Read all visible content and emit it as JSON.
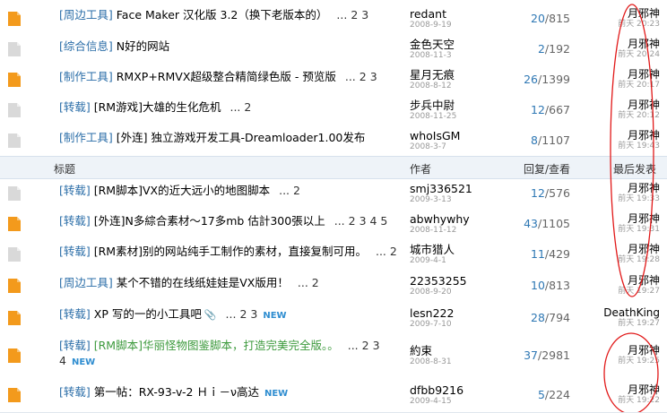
{
  "header": {
    "title_label": "标题",
    "author_label": "作者",
    "stats_label": "回复/查看",
    "last_post_label": "最后发表"
  },
  "rows": [
    {
      "icon": "hot",
      "category": "[周边工具]",
      "title": "Face Maker 汉化版 3.2（换下老版本的）",
      "title_color": "normal",
      "pages": "2 3",
      "new": "",
      "clip": false,
      "author": "redant",
      "date": "2008-9-19",
      "replies": "20",
      "views": "815",
      "lp_name": "月邪神",
      "lp_time": "前天 20:23"
    },
    {
      "icon": "normal",
      "category": "[综合信息]",
      "title": "N好的网站",
      "title_color": "normal",
      "pages": "",
      "new": "",
      "clip": false,
      "author": "金色天空",
      "date": "2008-11-3",
      "replies": "2",
      "views": "192",
      "lp_name": "月邪神",
      "lp_time": "前天 20:24"
    },
    {
      "icon": "hot",
      "category": "[制作工具]",
      "title": "RMXP+RMVX超级整合精简绿色版 - 预览版",
      "title_color": "normal",
      "pages": "2 3",
      "new": "",
      "clip": false,
      "author": "星月无痕",
      "date": "2008-8-12",
      "replies": "26",
      "views": "1399",
      "lp_name": "月邪神",
      "lp_time": "前天 20:17"
    },
    {
      "icon": "normal",
      "category": "[转载]",
      "title": "[RM游戏]大雄的生化危机",
      "title_color": "normal",
      "pages": "2",
      "new": "",
      "clip": false,
      "author": "步兵中尉",
      "date": "2008-11-25",
      "replies": "12",
      "views": "667",
      "lp_name": "月邪神",
      "lp_time": "前天 20:12"
    },
    {
      "icon": "normal",
      "category": "[制作工具]",
      "title": "[外连] 独立游戏开发工具-Dreamloader1.00发布",
      "title_color": "normal",
      "pages": "",
      "new": "",
      "clip": false,
      "author": "whoIsGM",
      "date": "2008-3-7",
      "replies": "8",
      "views": "1107",
      "lp_name": "月邪神",
      "lp_time": "前天 19:43"
    },
    {
      "icon": "normal",
      "category": "[转载]",
      "title": "[RM脚本]VX的近大远小的地图脚本",
      "title_color": "normal",
      "pages": "2",
      "new": "",
      "clip": false,
      "author": "smj336521",
      "date": "2009-3-13",
      "replies": "12",
      "views": "576",
      "lp_name": "月邪神",
      "lp_time": "前天 19:33"
    },
    {
      "icon": "hot",
      "category": "[转载]",
      "title": "[外连]N多綜合素材～17多mb 估計300張以上",
      "title_color": "normal",
      "pages": "2 3 4 5",
      "new": "",
      "clip": false,
      "author": "abwhywhy",
      "date": "2008-11-12",
      "replies": "43",
      "views": "1105",
      "lp_name": "月邪神",
      "lp_time": "前天 19:31"
    },
    {
      "icon": "normal",
      "category": "[转载]",
      "title": "[RM素材]别的网站纯手工制作的素材，直接复制可用。",
      "title_color": "normal",
      "pages": "2",
      "new": "",
      "clip": false,
      "author": "城市猎人",
      "date": "2009-4-1",
      "replies": "11",
      "views": "429",
      "lp_name": "月邪神",
      "lp_time": "前天 19:28"
    },
    {
      "icon": "hot",
      "category": "[周边工具]",
      "title": "某个不错的在线纸娃娃是VX版用！",
      "title_color": "normal",
      "pages": "2",
      "new": "",
      "clip": false,
      "author": "22353255",
      "date": "2008-9-20",
      "replies": "10",
      "views": "813",
      "lp_name": "月邪神",
      "lp_time": "前天 19:27"
    },
    {
      "icon": "hot",
      "category": "[转载]",
      "title": "XP 写的一的小工具吧",
      "title_color": "normal",
      "pages": "2 3",
      "new": "NEW",
      "clip": true,
      "author": "lesn222",
      "date": "2009-7-10",
      "replies": "28",
      "views": "794",
      "lp_name": "DeathKing",
      "lp_time": "前天 19:27"
    },
    {
      "icon": "hot",
      "category": "[转载]",
      "title": "[RM脚本]华丽怪物图鉴脚本，打造完美完全版。。",
      "title_color": "green",
      "pages": "2 3 4",
      "new": "NEW",
      "clip": false,
      "author": "約束",
      "date": "2008-8-31",
      "replies": "37",
      "views": "2981",
      "lp_name": "月邪神",
      "lp_time": "前天 19:25"
    },
    {
      "icon": "hot",
      "category": "[转载]",
      "title": "第一帖：RX-93-v-2 Ｈｉ－ν高达",
      "title_color": "normal",
      "pages": "",
      "new": "NEW",
      "clip": false,
      "author": "dfbb9216",
      "date": "2009-4-15",
      "replies": "5",
      "views": "224",
      "lp_name": "月邪神",
      "lp_time": "前天 19:22"
    }
  ],
  "colors": {
    "hot_icon": "#f39a1c",
    "normal_icon": "#d9d9d9",
    "category_link": "#2b6ea8",
    "reply_count": "#2f78b4",
    "annotation_red": "#e11818",
    "new_badge": "#2f8dd0"
  }
}
